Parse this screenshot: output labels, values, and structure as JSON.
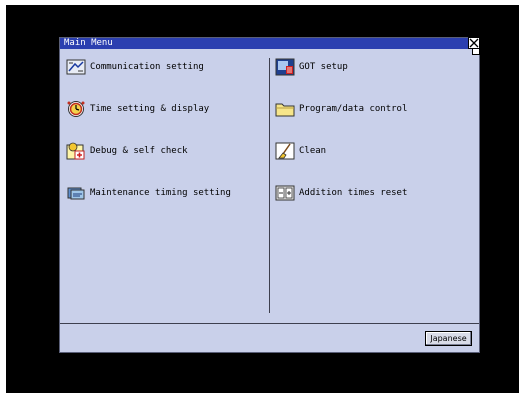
{
  "window": {
    "title": "Main Menu"
  },
  "menu_left": [
    {
      "label": "Communication setting",
      "icon": "communication-icon"
    },
    {
      "label": "Time setting & display",
      "icon": "time-icon"
    },
    {
      "label": "Debug & self check",
      "icon": "debug-icon"
    },
    {
      "label": "Maintenance timing setting",
      "icon": "maintenance-icon"
    }
  ],
  "menu_right": [
    {
      "label": "GOT setup",
      "icon": "got-setup-icon"
    },
    {
      "label": "Program/data control",
      "icon": "folder-icon"
    },
    {
      "label": "Clean",
      "icon": "clean-icon"
    },
    {
      "label": "Addition times reset",
      "icon": "reset-icon"
    }
  ],
  "footer": {
    "language_button": "Japanese"
  },
  "colors": {
    "titlebar": "#2b3fb0",
    "window_bg": "#c9d0ea",
    "screen_bg": "#000000"
  }
}
